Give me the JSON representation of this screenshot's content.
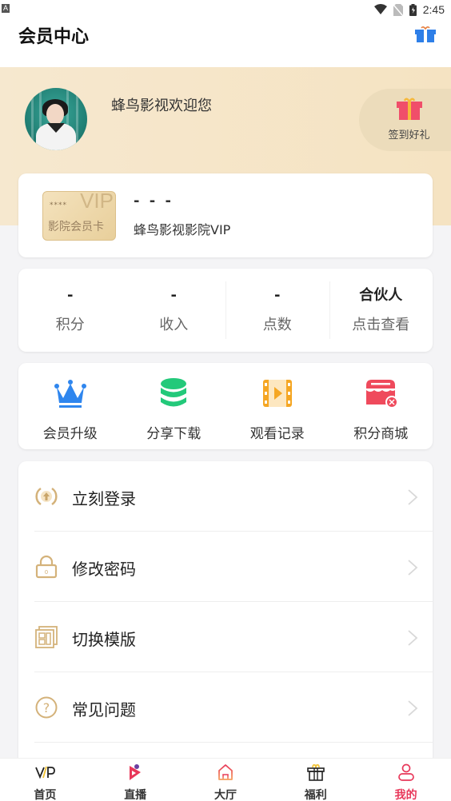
{
  "status_bar": {
    "time": "2:45",
    "left_indicator": "A"
  },
  "header": {
    "title": "会员中心",
    "gift_icon": "gift-icon"
  },
  "profile": {
    "welcome_text": "蜂鸟影视欢迎您",
    "signin_label": "签到好礼"
  },
  "vip_card": {
    "badge_stars": "****",
    "badge_vip": "VIP",
    "badge_name": "影院会员卡",
    "member_id": "- - -",
    "level_name": "蜂鸟影视影院VIP"
  },
  "stats": [
    {
      "value": "-",
      "label": "积分"
    },
    {
      "value": "-",
      "label": "收入"
    },
    {
      "value": "-",
      "label": "点数"
    },
    {
      "value": "合伙人",
      "label": "点击查看"
    }
  ],
  "quick_actions": [
    {
      "label": "会员升级",
      "icon": "crown-icon",
      "color": "#2f86ee"
    },
    {
      "label": "分享下载",
      "icon": "database-icon",
      "color": "#23c97a"
    },
    {
      "label": "观看记录",
      "icon": "film-icon",
      "color": "#f5a623"
    },
    {
      "label": "积分商城",
      "icon": "store-icon",
      "color": "#ef4a5c"
    }
  ],
  "menu": [
    {
      "label": "立刻登录",
      "icon": "login-icon"
    },
    {
      "label": "修改密码",
      "icon": "lock-icon"
    },
    {
      "label": "切换模版",
      "icon": "template-icon"
    },
    {
      "label": "常见问题",
      "icon": "question-icon"
    }
  ],
  "tabbar": [
    {
      "label": "首页",
      "icon": "vip-icon",
      "active": false
    },
    {
      "label": "直播",
      "icon": "live-icon",
      "active": false
    },
    {
      "label": "大厅",
      "icon": "home-icon",
      "active": false
    },
    {
      "label": "福利",
      "icon": "gift-icon",
      "active": false
    },
    {
      "label": "我的",
      "icon": "user-icon",
      "active": true
    }
  ],
  "colors": {
    "accent": "#e8385a",
    "gold": "#d4b27a",
    "banner": "#f5e4c5"
  }
}
